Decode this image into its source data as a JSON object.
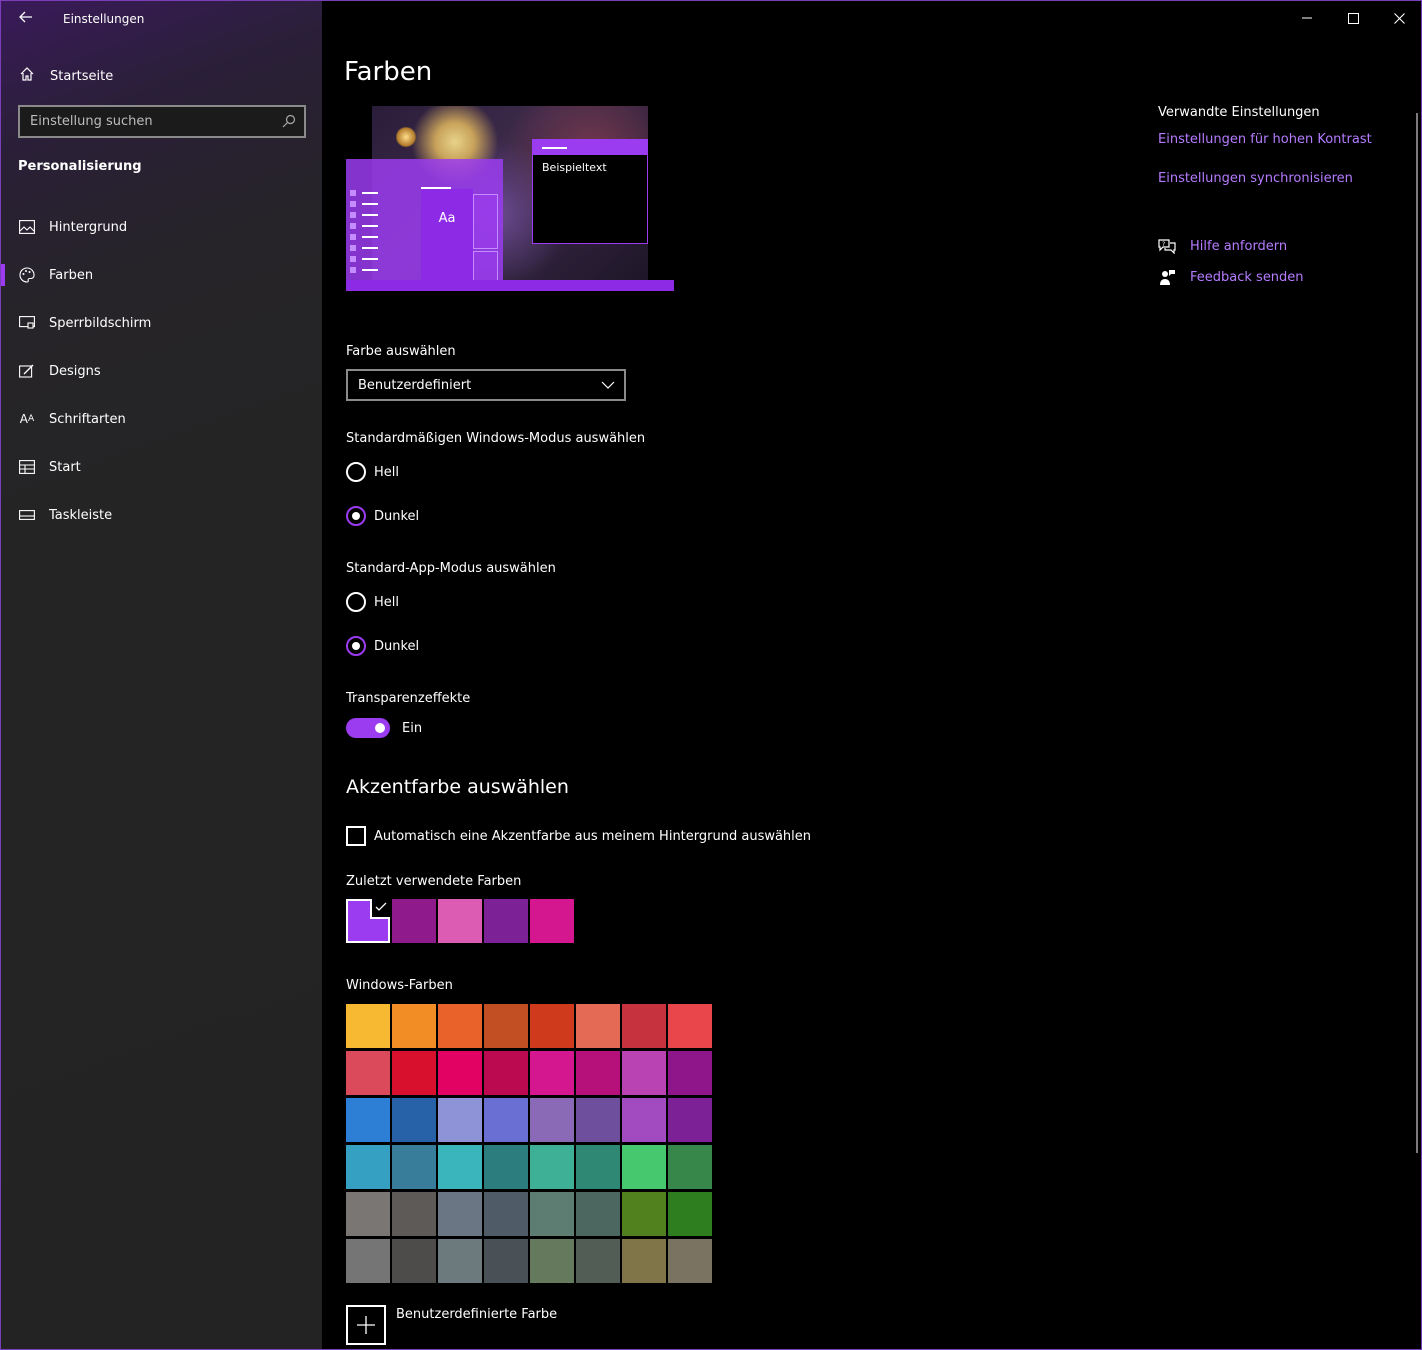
{
  "window": {
    "title": "Einstellungen"
  },
  "sidebar": {
    "home_label": "Startseite",
    "search_placeholder": "Einstellung suchen",
    "section": "Personalisierung",
    "items": [
      {
        "label": "Hintergrund",
        "icon": "image-icon"
      },
      {
        "label": "Farben",
        "icon": "palette-icon",
        "selected": true
      },
      {
        "label": "Sperrbildschirm",
        "icon": "lock-screen-icon"
      },
      {
        "label": "Designs",
        "icon": "brush-icon"
      },
      {
        "label": "Schriftarten",
        "icon": "font-icon"
      },
      {
        "label": "Start",
        "icon": "start-icon"
      },
      {
        "label": "Taskleiste",
        "icon": "taskbar-icon"
      }
    ]
  },
  "main": {
    "title": "Farben",
    "preview": {
      "sample_text": "Beispieltext",
      "tile_text": "Aa"
    },
    "color_select": {
      "label": "Farbe auswählen",
      "value": "Benutzerdefiniert"
    },
    "windows_mode": {
      "label": "Standardmäßigen Windows-Modus auswählen",
      "options": [
        "Hell",
        "Dunkel"
      ],
      "selected": "Dunkel"
    },
    "app_mode": {
      "label": "Standard-App-Modus auswählen",
      "options": [
        "Hell",
        "Dunkel"
      ],
      "selected": "Dunkel"
    },
    "transparency": {
      "label": "Transparenzeffekte",
      "state": "Ein",
      "on": true
    },
    "accent": {
      "heading": "Akzentfarbe auswählen",
      "auto_label": "Automatisch eine Akzentfarbe aus meinem Hintergrund auswählen",
      "auto_checked": false,
      "recent_label": "Zuletzt verwendete Farben",
      "recent_colors": [
        "#9b3cf0",
        "#8f1a8c",
        "#dc5bb3",
        "#7d2296",
        "#d4178f"
      ],
      "windows_label": "Windows-Farben",
      "windows_colors": [
        [
          "#f7b932",
          "#f28c24",
          "#e8622a",
          "#c14f23",
          "#cf3a1c",
          "#e56a55",
          "#c6333f",
          "#e8464b"
        ],
        [
          "#da4a5a",
          "#d9102d",
          "#e20263",
          "#bb0a4f",
          "#d4178f",
          "#b6107b",
          "#b943b3",
          "#8e168a"
        ],
        [
          "#2d7fd6",
          "#2761a8",
          "#8e92d6",
          "#6a6fd4",
          "#8a6ab6",
          "#6e4f9e",
          "#a24abf",
          "#7d2296"
        ],
        [
          "#36a0c2",
          "#387e9b",
          "#3ab5bb",
          "#2c7d7d",
          "#3eb095",
          "#2e8874",
          "#45c86e",
          "#37874b"
        ],
        [
          "#7a7674",
          "#5d5a58",
          "#6b7685",
          "#505b68",
          "#5d7c72",
          "#4b675f",
          "#51801f",
          "#2e7d1f"
        ],
        [
          "#757575",
          "#4d4c4b",
          "#6c7a7d",
          "#4a5156",
          "#657a5d",
          "#525e55",
          "#807548",
          "#7b7361"
        ]
      ],
      "custom_label": "Benutzerdefinierte Farbe"
    }
  },
  "related": {
    "title": "Verwandte Einstellungen",
    "links": [
      "Einstellungen für hohen Kontrast",
      "Einstellungen synchronisieren"
    ],
    "help": "Hilfe anfordern",
    "feedback": "Feedback senden"
  },
  "colors": {
    "accent": "#9b3cf0",
    "link": "#b57cff",
    "sidebar_bg": "#242424",
    "main_bg": "#000000"
  }
}
